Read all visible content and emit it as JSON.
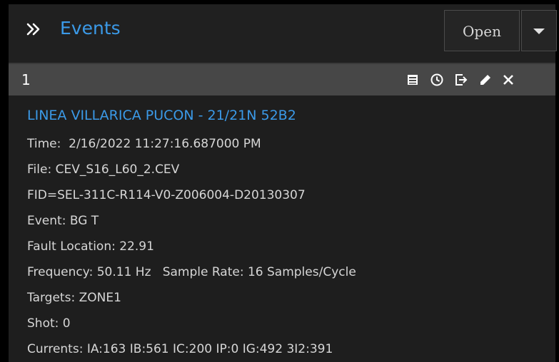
{
  "header": {
    "title": "Events",
    "expand_icon": "double-chevron-right-icon",
    "open_label": "Open",
    "dropdown_icon": "caret-down-icon"
  },
  "event": {
    "number": "1",
    "toolbar_icons": [
      "report-icon",
      "clock-icon",
      "export-icon",
      "pencil-icon",
      "close-icon"
    ],
    "name": "LINEA VILLARICA PUCON - 21/21N 52B2",
    "lines": {
      "time": "Time:  2/16/2022 11:27:16.687000 PM",
      "file": "File: CEV_S16_L60_2.CEV",
      "fid": "FID=SEL-311C-R114-V0-Z006004-D20130307",
      "event": "Event: BG T",
      "fault_location": "Fault Location: 22.91",
      "frequency": "Frequency: 50.11 Hz   Sample Rate: 16 Samples/Cycle",
      "targets": "Targets: ZONE1",
      "shot": "Shot: 0",
      "currents": "Currents: IA:163 IB:561 IC:200 IP:0 IG:492 3I2:391"
    }
  },
  "colors": {
    "accent": "#3b9ae8",
    "text": "#d6d6d6",
    "bar": "#474747",
    "background": "#1e1e1e"
  }
}
